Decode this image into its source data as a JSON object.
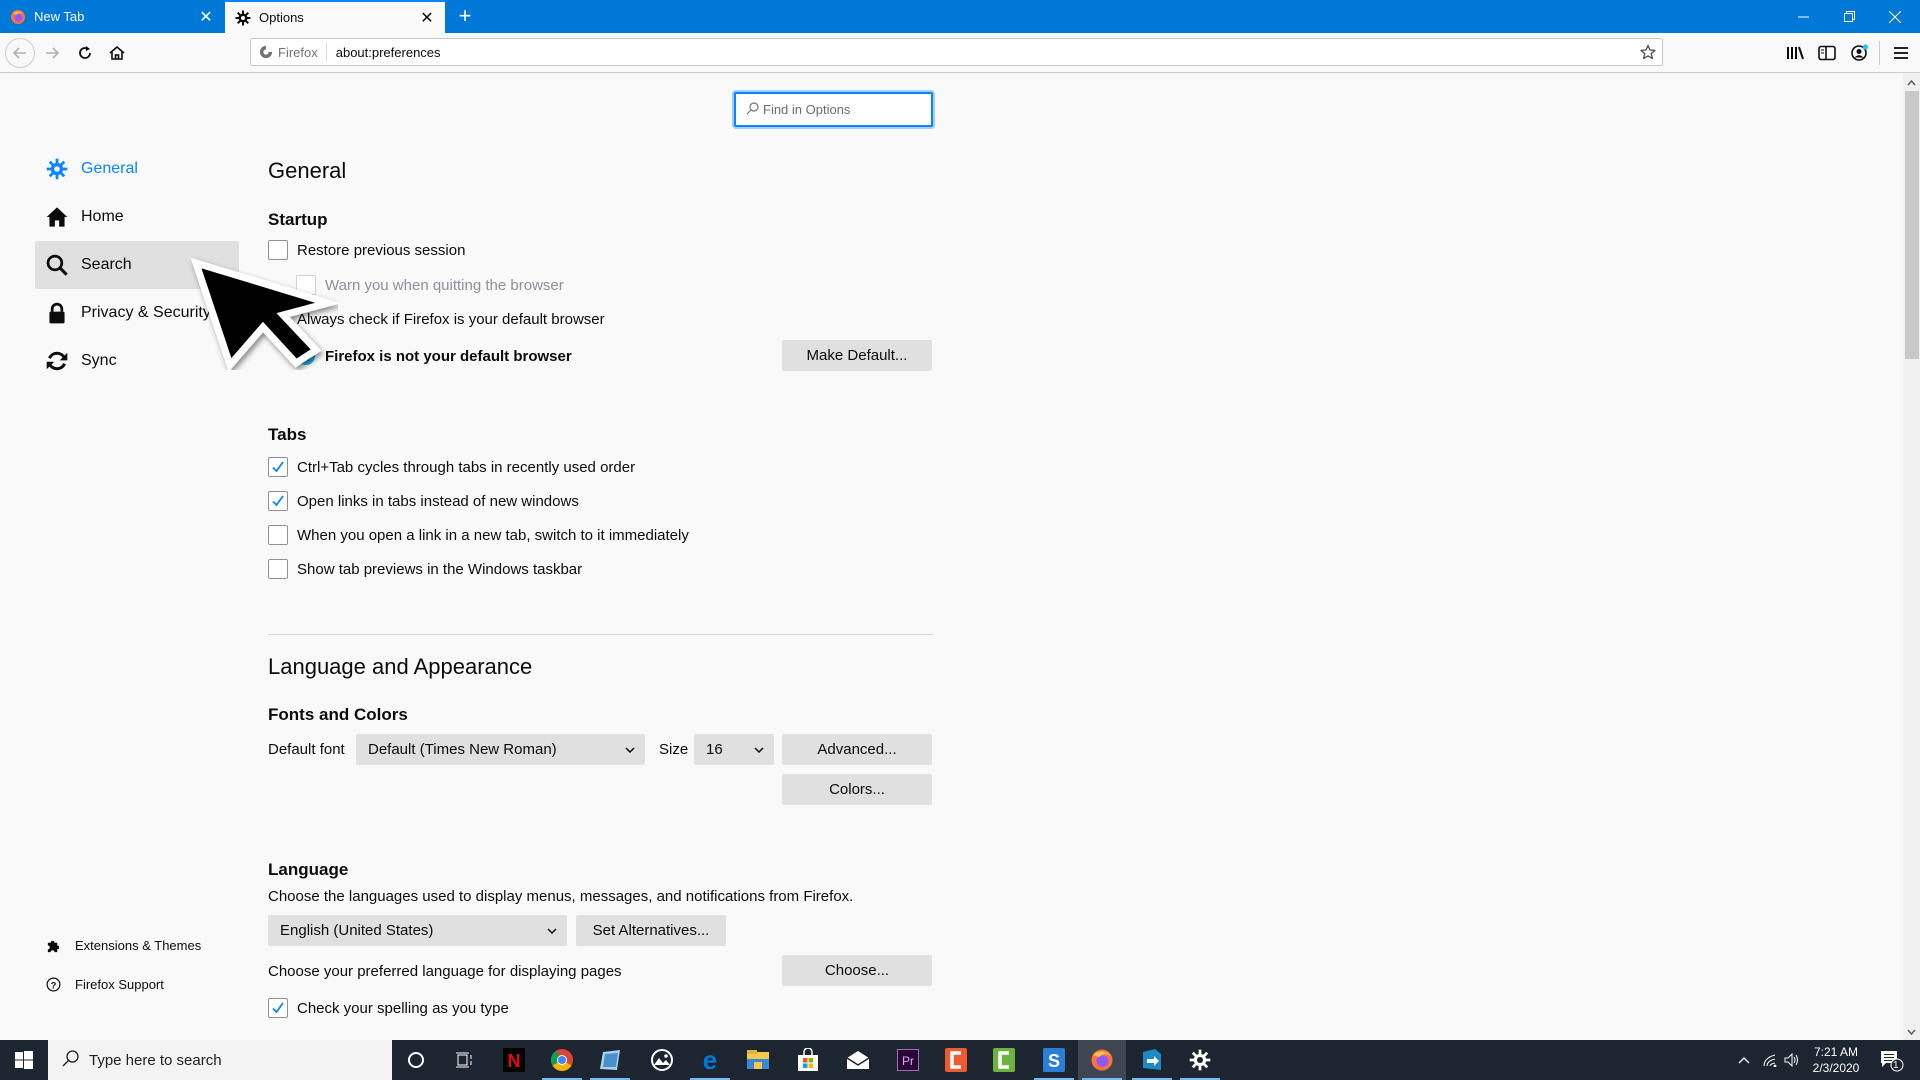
{
  "browser": {
    "tabs": [
      {
        "label": "New Tab",
        "icon": "firefox-icon",
        "active": false
      },
      {
        "label": "Options",
        "icon": "gear-icon",
        "active": true
      }
    ],
    "new_tab_symbol": "+",
    "window_controls": {
      "minimize": "—",
      "restore": "❐",
      "close": "✕"
    },
    "urlbar": {
      "identity_label": "Firefox",
      "url": "about:preferences"
    }
  },
  "search": {
    "placeholder": "Find in Options",
    "value": ""
  },
  "sidebar": {
    "categories": [
      {
        "label": "General",
        "icon": "gear-icon",
        "selected": true
      },
      {
        "label": "Home",
        "icon": "home-icon",
        "selected": false
      },
      {
        "label": "Search",
        "icon": "search-icon",
        "selected": false
      },
      {
        "label": "Privacy & Security",
        "icon": "lock-icon",
        "selected": false
      },
      {
        "label": "Sync",
        "icon": "sync-icon",
        "selected": false
      }
    ],
    "footer": [
      {
        "label": "Extensions & Themes",
        "icon": "puzzle-icon"
      },
      {
        "label": "Firefox Support",
        "icon": "help-icon"
      }
    ]
  },
  "general": {
    "title": "General",
    "startup": {
      "heading": "Startup",
      "restore_session": {
        "label": "Restore previous session",
        "checked": false
      },
      "warn_quit": {
        "label": "Warn you when quitting the browser",
        "checked": false,
        "disabled": true
      },
      "always_check_default": {
        "label": "Always check if Firefox is your default browser",
        "checked": true
      },
      "default_status": "Firefox is not your default browser",
      "make_default_button": "Make Default..."
    },
    "tabs": {
      "heading": "Tabs",
      "options": [
        {
          "label": "Ctrl+Tab cycles through tabs in recently used order",
          "checked": true
        },
        {
          "label": "Open links in tabs instead of new windows",
          "checked": true
        },
        {
          "label": "When you open a link in a new tab, switch to it immediately",
          "checked": false
        },
        {
          "label": "Show tab previews in the Windows taskbar",
          "checked": false
        }
      ]
    }
  },
  "language_appearance": {
    "title": "Language and Appearance",
    "fonts": {
      "heading": "Fonts and Colors",
      "default_font_label": "Default font",
      "default_font_value": "Default (Times New Roman)",
      "size_label": "Size",
      "size_value": "16",
      "advanced_button": "Advanced...",
      "colors_button": "Colors..."
    },
    "language": {
      "heading": "Language",
      "description": "Choose the languages used to display menus, messages, and notifications from Firefox.",
      "ui_language_value": "English (United States)",
      "set_alternatives_button": "Set Alternatives...",
      "page_language_label": "Choose your preferred language for displaying pages",
      "choose_button": "Choose...",
      "spellcheck": {
        "label": "Check your spelling as you type",
        "checked": true
      }
    }
  },
  "taskbar": {
    "search_placeholder": "Type here to search",
    "apps": [
      "cortana",
      "task-view",
      "netflix",
      "chrome",
      "notepad",
      "photos",
      "edge",
      "file-explorer",
      "store",
      "mail",
      "premiere",
      "camtasia",
      "camtasia-green",
      "snagit",
      "firefox",
      "teamviewer",
      "settings"
    ],
    "time": "7:21 AM",
    "date": "2/3/2020",
    "notification_count": "1"
  },
  "colors": {
    "accent": "#0a84ff",
    "titlebar": "#0078d7",
    "taskbar": "#1c2530"
  }
}
